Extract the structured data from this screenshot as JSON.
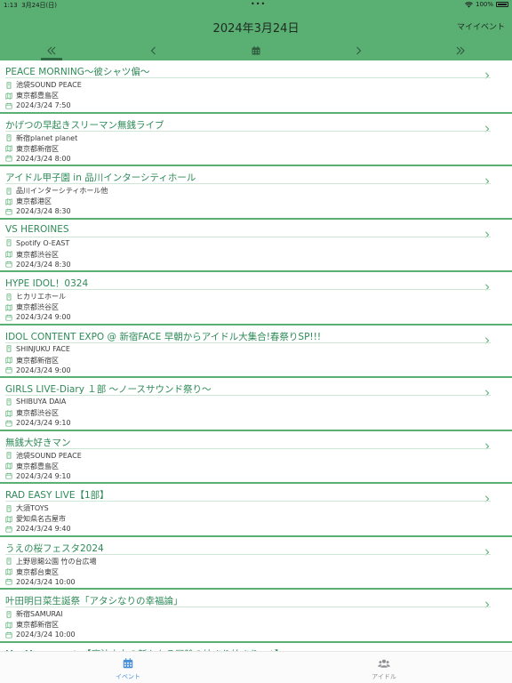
{
  "status_bar": {
    "time": "1:13",
    "date": "3月24日(日)",
    "battery": "100%"
  },
  "header": {
    "title": "2024年3月24日",
    "my_events_label": "マイイベント"
  },
  "events": [
    {
      "title": "PEACE MORNING〜彼シャツ偏〜",
      "venue": "池袋SOUND PEACE",
      "area": "東京都豊島区",
      "datetime": "2024/3/24  7:50"
    },
    {
      "title": "かげつの早起きスリーマン無銭ライブ",
      "venue": "新宿planet planet",
      "area": "東京都新宿区",
      "datetime": "2024/3/24  8:00"
    },
    {
      "title": "アイドル甲子園 in 品川インターシティホール",
      "venue": "品川インターシティホール他",
      "area": "東京都港区",
      "datetime": "2024/3/24  8:30"
    },
    {
      "title": "VS HEROINES",
      "venue": "Spotify O-EAST",
      "area": "東京都渋谷区",
      "datetime": "2024/3/24  8:30"
    },
    {
      "title": "HYPE IDOL！0324",
      "venue": "ヒカリエホール",
      "area": "東京都渋谷区",
      "datetime": "2024/3/24  9:00"
    },
    {
      "title": "IDOL CONTENT EXPO @ 新宿FACE 早朝からアイドル大集合!春祭りSP!!!",
      "venue": "SHINJUKU FACE",
      "area": "東京都新宿区",
      "datetime": "2024/3/24  9:00"
    },
    {
      "title": "GIRLS LIVE-Diary １部 〜ノースサウンド祭り〜",
      "venue": "SHIBUYA DAIA",
      "area": "東京都渋谷区",
      "datetime": "2024/3/24  9:10"
    },
    {
      "title": "無銭大好きマン",
      "venue": "池袋SOUND PEACE",
      "area": "東京都豊島区",
      "datetime": "2024/3/24  9:10"
    },
    {
      "title": "RAD EASY LIVE【1部】",
      "venue": "大須TOYS",
      "area": "愛知県名古屋市",
      "datetime": "2024/3/24  9:40"
    },
    {
      "title": "うえの桜フェスタ2024",
      "venue": "上野恩賜公園 竹の台広場",
      "area": "東京都台東区",
      "datetime": "2024/3/24  10:00"
    },
    {
      "title": "叶田明日菜生誕祭「アタシなりの幸福論」",
      "venue": "新宿SAMURAI",
      "area": "東京都新宿区",
      "datetime": "2024/3/24  10:00"
    },
    {
      "title": "MyuMe presents【魔法少女の新たなる冒険の始まり始まり〜♪】",
      "venue": "",
      "area": "",
      "datetime": ""
    }
  ],
  "tabs": [
    {
      "label": "イベント",
      "icon": "calendar-icon"
    },
    {
      "label": "アイドル",
      "icon": "people-icon"
    }
  ],
  "colors": {
    "header_bg": "#5aaf73",
    "accent": "#2e8b57",
    "active_tab": "#4a90d9",
    "inactive_tab": "#8e8e93"
  }
}
